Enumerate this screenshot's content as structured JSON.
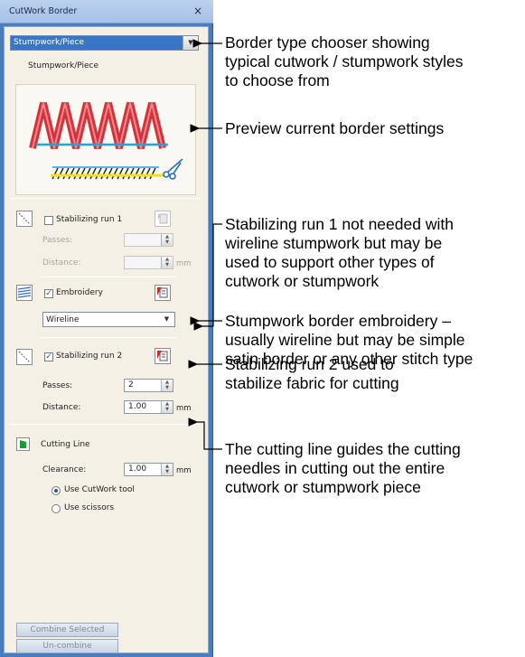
{
  "panel": {
    "title": "CutWork Border",
    "close_glyph": "×",
    "border_type": "Stumpwork/Piece",
    "preview_caption": "Stumpwork/Piece",
    "stab1": {
      "label": "Stabilizing run 1",
      "checked": false,
      "passes_label": "Passes:",
      "distance_label": "Distance:",
      "passes": "",
      "distance": "",
      "unit": "mm"
    },
    "embroidery": {
      "label": "Embroidery",
      "checked": true,
      "stitch_type": "Wireline"
    },
    "stab2": {
      "label": "Stabilizing run 2",
      "checked": true,
      "passes_label": "Passes:",
      "distance_label": "Distance:",
      "passes": "2",
      "distance": "1.00",
      "unit": "mm"
    },
    "cutting": {
      "label": "Cutting Line",
      "clearance_label": "Clearance:",
      "clearance": "1.00",
      "unit": "mm",
      "option_tool": "Use CutWork tool",
      "option_scissors": "Use scissors",
      "selected": "tool"
    },
    "buttons": {
      "combine": "Combine Selected",
      "uncombine": "Un-combine"
    }
  },
  "callouts": {
    "border_type": [
      "Border type chooser showing",
      "typical cutwork / stumpwork styles",
      "to choose from"
    ],
    "preview": [
      "Preview current border settings"
    ],
    "stab1": [
      "Stabilizing run 1 not needed with",
      "wireline stumpwork but may be",
      "used to support other types of",
      "cutwork or stumpwork"
    ],
    "embroidery": [
      "Stumpwork border embroidery –",
      "usually wireline but may be simple",
      "satin border or any other stitch type"
    ],
    "stab2": [
      "Stabilizing run 2 used to",
      "stabilize fabric for cutting"
    ],
    "cutting": [
      "The cutting line guides the cutting",
      "needles in cutting out the entire",
      "cutwork or stumpwork piece"
    ]
  },
  "colors": {
    "panel_frame": "#4a7cc0",
    "panel_bg": "#f4f0e6",
    "selection": "#3a76c7",
    "stitch_red": "#d3343c",
    "guide_blue": "#2aa2d8",
    "cut_yellow": "#f2e01a"
  },
  "icons": [
    "close-icon",
    "dropdown-arrow-icon",
    "run-stitch-icon",
    "embroidery-stitch-icon",
    "cutting-line-icon",
    "properties-icon",
    "scissors-icon"
  ]
}
